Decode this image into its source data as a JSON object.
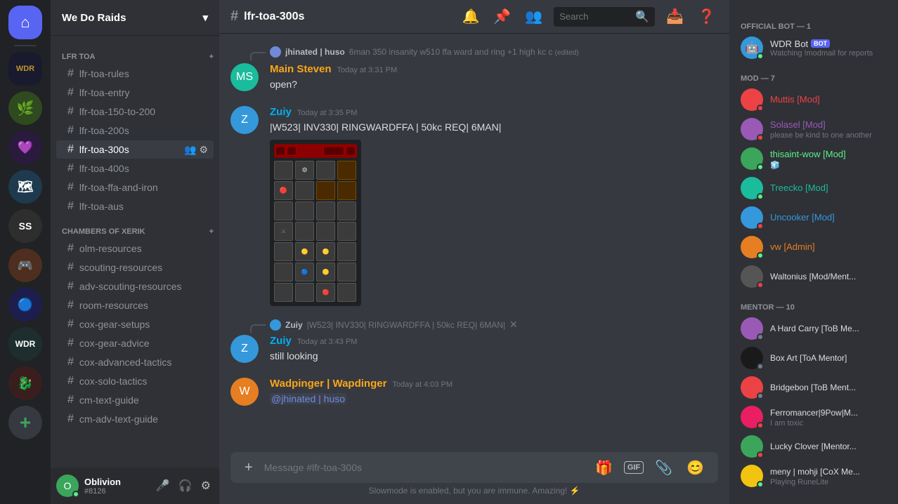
{
  "app": {
    "title": "Discord"
  },
  "server": {
    "name": "We Do Raids",
    "chevron": "▾"
  },
  "channel": {
    "name": "lfr-toa-300s",
    "category_lfr": "LFR TOA",
    "category_cox": "CHAMBERS OF XERIK"
  },
  "channels_lfr": [
    {
      "id": "lfr-toa-rules",
      "label": "lfr-toa-rules",
      "active": false
    },
    {
      "id": "lfr-toa-entry",
      "label": "lfr-toa-entry",
      "active": false
    },
    {
      "id": "lfr-150-to-200",
      "label": "lfr-toa-150-to-200",
      "active": false
    },
    {
      "id": "lfr-toa-200s",
      "label": "lfr-toa-200s",
      "active": false
    },
    {
      "id": "lfr-toa-300s",
      "label": "lfr-toa-300s",
      "active": true
    },
    {
      "id": "lfr-toa-400s",
      "label": "lfr-toa-400s",
      "active": false
    },
    {
      "id": "lfr-toa-ffa-and-iron",
      "label": "lfr-toa-ffa-and-iron",
      "active": false
    },
    {
      "id": "lfr-toa-aus",
      "label": "lfr-toa-aus",
      "active": false
    }
  ],
  "channels_cox": [
    {
      "id": "olm-resources",
      "label": "olm-resources",
      "active": false
    },
    {
      "id": "scouting-resources",
      "label": "scouting-resources",
      "active": false
    },
    {
      "id": "adv-scouting-resources",
      "label": "adv-scouting-resources",
      "active": false
    },
    {
      "id": "room-resources",
      "label": "room-resources",
      "active": false
    },
    {
      "id": "cox-gear-setups",
      "label": "cox-gear-setups",
      "active": false
    },
    {
      "id": "cox-gear-advice",
      "label": "cox-gear-advice",
      "active": false
    },
    {
      "id": "cox-advanced-tactics",
      "label": "cox-advanced-tactics",
      "active": false
    },
    {
      "id": "cox-solo-tactics",
      "label": "cox-solo-tactics",
      "active": false
    },
    {
      "id": "cm-text-guide",
      "label": "cm-text-guide",
      "active": false
    },
    {
      "id": "cm-adv-text-guide",
      "label": "cm-adv-text-guide",
      "active": false
    }
  ],
  "messages": [
    {
      "id": "msg1",
      "is_reply": true,
      "reply_user": "jhinated | huso",
      "reply_content": "6man 350 insanity w510 ffa ward and ring +1 high kc c (edited)",
      "avatar_color": "av-teal",
      "avatar_text": "MS",
      "username": "Main Steven",
      "username_color": "gold",
      "timestamp": "Today at 3:31 PM",
      "content": "open?"
    },
    {
      "id": "msg2",
      "is_reply": false,
      "avatar_color": "av-blue",
      "avatar_text": "Z",
      "username": "Zuiy",
      "username_color": "blue",
      "timestamp": "Today at 3:35 PM",
      "content": "|W523| INV330| RINGWARDFFA | 50kc REQ| 6MAN|",
      "has_image": true
    },
    {
      "id": "msg3",
      "is_reply": true,
      "reply_user": "Zuiy",
      "reply_content": "|W523| INV330| RINGWARDFFA | 50kc REQ| 6MAN|",
      "avatar_color": "av-blue",
      "avatar_text": "Z",
      "username": "Zuiy",
      "username_color": "blue",
      "timestamp": "Today at 3:43 PM",
      "content": "still looking"
    },
    {
      "id": "msg4",
      "is_reply": false,
      "avatar_color": "av-orange",
      "avatar_text": "W",
      "username": "Wadpinger | Wapdinger",
      "username_color": "gold",
      "timestamp": "Today at 4:03 PM",
      "content_mention": "@jhinated | huso",
      "content_after": ""
    }
  ],
  "input": {
    "placeholder": "Message #lfr-toa-300s"
  },
  "slowmode": "Slowmode is enabled, but you are immune. Amazing! ⚡",
  "search": {
    "placeholder": "Search"
  },
  "members": {
    "official_bot_label": "OFFICIAL BOT — 1",
    "mod_label": "MOD — 7",
    "mentor_label": "MENTOR — 10",
    "bot": {
      "name": "WDR Bot",
      "status": "Watching !modmail for reports",
      "badge": "BOT"
    },
    "mods": [
      {
        "name": "Muttis [Mod]",
        "color": "av-red"
      },
      {
        "name": "Solasel [Mod]",
        "status": "please be kind to one another",
        "color": "av-purple"
      },
      {
        "name": "thisaint-wow [Mod]",
        "status": "🧊",
        "color": "av-green"
      },
      {
        "name": "Treecko [Mod]",
        "color": "av-teal"
      },
      {
        "name": "Uncooker [Mod]",
        "color": "av-blue"
      },
      {
        "name": "vw [Admin]",
        "color": "av-orange"
      },
      {
        "name": "Waltonius [Mod/Ment...",
        "color": "av-dark"
      }
    ],
    "mentors": [
      {
        "name": "A Hard Carry [ToB Me...",
        "color": "av-purple"
      },
      {
        "name": "Box Art [ToA Mentor]",
        "color": "av-blue"
      },
      {
        "name": "Bridgebon [ToB Ment...",
        "color": "av-red"
      },
      {
        "name": "Ferromancer|9Pow|M...",
        "status": "I am toxic",
        "color": "av-pink"
      },
      {
        "name": "Lucky Clover [Mentor...",
        "color": "av-green"
      },
      {
        "name": "meny | mohji [CoX Me...",
        "status": "Playing RuneLite",
        "color": "av-yellow"
      }
    ]
  },
  "user": {
    "name": "Oblivion",
    "tag": "#8126",
    "color": "av-green"
  },
  "icons": {
    "hash": "#",
    "bell": "🔔",
    "pin": "📌",
    "members": "👥",
    "search": "🔍",
    "inbox": "📥",
    "help": "❓",
    "mic": "🎤",
    "headphones": "🎧",
    "settings": "⚙",
    "gift": "🎁",
    "gif": "GIF",
    "sticker": "📎",
    "emoji": "😊",
    "plus": "+"
  }
}
